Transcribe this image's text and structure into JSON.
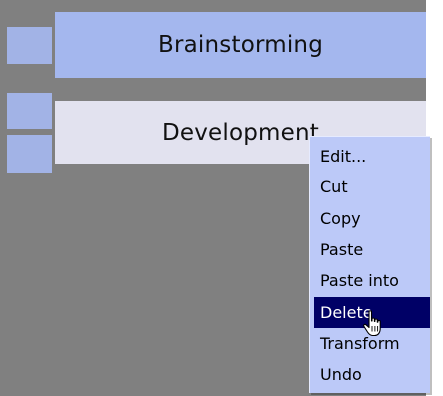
{
  "nodes": {
    "brainstorming_label": "Brainstorming",
    "development_label": "Development"
  },
  "context_menu": {
    "items": [
      {
        "label": "Edit..."
      },
      {
        "label": "Cut"
      },
      {
        "label": "Copy"
      },
      {
        "label": "Paste"
      },
      {
        "label": "Paste into"
      },
      {
        "label": "Delete",
        "selected": true
      },
      {
        "label": "Transform"
      },
      {
        "label": "Undo"
      }
    ]
  },
  "cursor": {
    "icon": "hand-pointer-icon"
  },
  "colors": {
    "canvas": "#808080",
    "node_active": "#a4b7ee",
    "node_inactive": "#e2e2ef",
    "menu_bg": "#bcc9f8",
    "menu_highlight": "#000066"
  }
}
